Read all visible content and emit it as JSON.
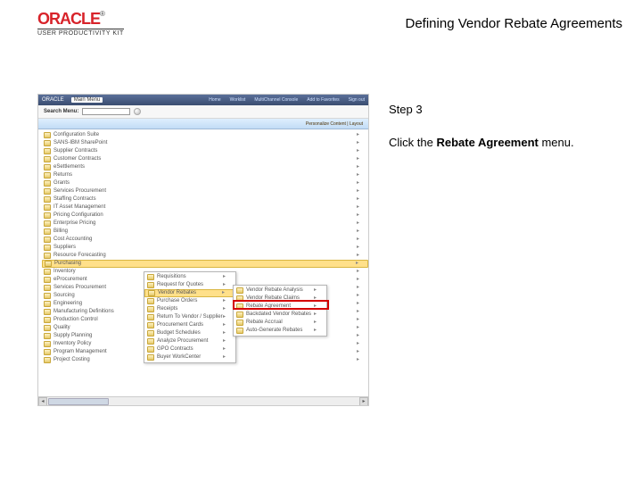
{
  "brand": {
    "name": "ORACLE",
    "tm": "®",
    "product": "USER PRODUCTIVITY KIT"
  },
  "page": {
    "title": "Defining Vendor Rebate Agreements"
  },
  "instructions": {
    "step_label": "Step 3",
    "body_prefix": "Click the ",
    "body_bold": "Rebate Agreement",
    "body_suffix": " menu."
  },
  "ss": {
    "topbar": {
      "oracle": "ORACLE",
      "main": "Main Menu",
      "nav": [
        "Home",
        "Worklist",
        "MultiChannel Console",
        "Add to Favorites",
        "Sign out"
      ]
    },
    "search": {
      "label": "Search Menu:",
      "placeholder": ""
    },
    "bar_right": "Personalize Content | Layout",
    "menu": [
      "Configuration Suite",
      "SANS-IBM SharePoint",
      "Supplier Contracts",
      "Customer Contracts",
      "eSettlements",
      "Returns",
      "Grants",
      "Services Procurement",
      "Staffing Contracts",
      "IT Asset Management",
      "Pricing Configuration",
      "Enterprise Pricing",
      "Billing",
      "Cost Accounting",
      "Suppliers",
      "Resource Forecasting"
    ],
    "menu_selected": "Purchasing",
    "menu_tail": [
      "Inventory",
      "eProcurement",
      "Services Procurement",
      "Sourcing",
      "Engineering",
      "Manufacturing Definitions",
      "Production Control",
      "Quality",
      "Supply Planning",
      "Inventory Policy",
      "Program Management",
      "Project Costing"
    ],
    "submenu": [
      "Requisitions",
      "Request for Quotes"
    ],
    "submenu_selected": "Vendor Rebates",
    "submenu_tail": [
      "Purchase Orders",
      "Receipts",
      "Return To Vendor / Supplier",
      "Procurement Cards",
      "Budget Schedules",
      "Analyze Procurement",
      "GPO Contracts",
      "Buyer WorkCenter"
    ],
    "submenu2": [
      "Vendor Rebate Analysis",
      "Vendor Rebate Claims"
    ],
    "submenu2_target": "Rebate Agreement",
    "submenu2_tail": [
      "Backdated Vendor Rebates",
      "Rebate Accrual",
      "Auto-Generate Rebates"
    ]
  }
}
